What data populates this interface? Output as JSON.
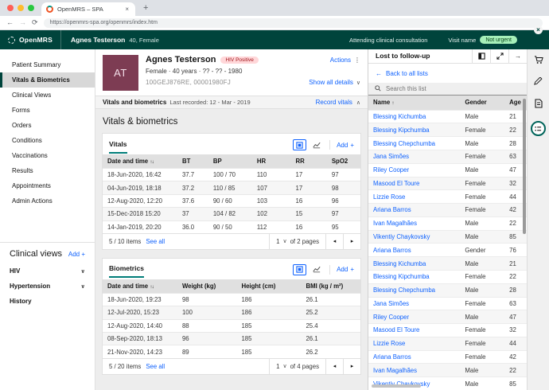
{
  "colors": {
    "header_teal": "#00443c",
    "link_blue": "#0f62fe",
    "tab_underline_teal": "#007d79",
    "avatar_plum": "#7d3c53",
    "badge_hiv_bg": "#ffd7d9",
    "badge_hiv_text": "#a2191f",
    "badge_visit_bg": "#a7f0ba",
    "badge_visit_text": "#044317"
  },
  "browser": {
    "tab_title": "OpenMRS – SPA",
    "url": "https://openmrs-spa.org/openmrs/index.htm"
  },
  "header": {
    "brand": "OpenMRS",
    "patient_name": "Agnes Testerson",
    "patient_meta": "40, Female",
    "status_text": "Attending clinical consultation",
    "visit_label": "Visit name",
    "visit_badge": "Not urgent"
  },
  "sidebar": {
    "items": [
      {
        "label": "Patient Summary"
      },
      {
        "label": "Vitals & Biometrics"
      },
      {
        "label": "Clinical Views"
      },
      {
        "label": "Forms"
      },
      {
        "label": "Orders"
      },
      {
        "label": "Conditions"
      },
      {
        "label": "Vaccinations"
      },
      {
        "label": "Results"
      },
      {
        "label": "Appointments"
      },
      {
        "label": "Admin Actions"
      }
    ],
    "clinical_views": {
      "title": "Clinical views",
      "add_label": "Add",
      "items": [
        {
          "label": "HIV"
        },
        {
          "label": "Hypertension"
        },
        {
          "label": "History"
        }
      ]
    }
  },
  "banner": {
    "initials": "AT",
    "name": "Agnes Testerson",
    "hiv_badge": "HIV Positive",
    "actions_label": "Actions",
    "demographics": "Female  ·  40 years  ·  ?? - ?? - 1980",
    "identifiers": "100GEJ876RE, 00001980FJ",
    "show_all_label": "Show all details"
  },
  "strip": {
    "title": "Vitals and biometrics",
    "last_recorded": "Last recorded: 12 - Mar - 2019",
    "record_label": "Record vitals"
  },
  "main": {
    "page_title": "Vitals & biometrics"
  },
  "vitals": {
    "title": "Vitals",
    "add_label": "Add",
    "columns": [
      "Date and time",
      "BT",
      "BP",
      "HR",
      "RR",
      "SpO2"
    ],
    "rows": [
      [
        "18-Jun-2020, 16:42",
        "37.7",
        "100 / 70",
        "110",
        "17",
        "97"
      ],
      [
        "04-Jun-2019, 18:18",
        "37.2",
        "110 / 85",
        "107",
        "17",
        "98"
      ],
      [
        "12-Aug-2020, 12:20",
        "37.6",
        "90 / 60",
        "103",
        "16",
        "96"
      ],
      [
        "15-Dec-2018 15:20",
        "37",
        "104 / 82",
        "102",
        "15",
        "97"
      ],
      [
        "14-Jan-2019, 20:20",
        "36.0",
        "90 / 50",
        "112",
        "16",
        "95"
      ]
    ],
    "pagination": {
      "count": "5 / 10 items",
      "see_all": "See all",
      "page": "1",
      "of_pages": "of 2 pages"
    }
  },
  "biometrics": {
    "title": "Biometrics",
    "add_label": "Add",
    "columns": [
      "Date and time",
      "Weight (kg)",
      "Height (cm)",
      "BMI (kg / m²)"
    ],
    "rows": [
      [
        "18-Jun-2020, 19:23",
        "98",
        "186",
        "26.1"
      ],
      [
        "12-Jul-2020, 15:23",
        "100",
        "186",
        "25.2"
      ],
      [
        "12-Aug-2020, 14:40",
        "88",
        "185",
        "25.4"
      ],
      [
        "08-Sep-2020, 18:13",
        "96",
        "185",
        "26.1"
      ],
      [
        "21-Nov-2020, 14:23",
        "89",
        "185",
        "26.2"
      ]
    ],
    "pagination": {
      "count": "5 / 20 items",
      "see_all": "See all",
      "page": "1",
      "of_pages": "of 4 pages"
    }
  },
  "patient_list": {
    "title": "Lost to follow-up",
    "back_label": "Back to all lists",
    "search_placeholder": "Search this list",
    "columns": [
      "Name",
      "Gender",
      "Age"
    ],
    "rows": [
      {
        "name": "Blessing Kichumba",
        "gender": "Male",
        "age": "21"
      },
      {
        "name": "Blessing Kipchumba",
        "gender": "Female",
        "age": "22"
      },
      {
        "name": "Blessing Chepchumba",
        "gender": "Male",
        "age": "28"
      },
      {
        "name": "Jana Simões",
        "gender": "Female",
        "age": "63"
      },
      {
        "name": "Riley Cooper",
        "gender": "Male",
        "age": "47"
      },
      {
        "name": "Masood El Toure",
        "gender": "Female",
        "age": "32"
      },
      {
        "name": "Lizzie Rose",
        "gender": "Female",
        "age": "44"
      },
      {
        "name": "Ariana Barros",
        "gender": "Female",
        "age": "42"
      },
      {
        "name": "Ivan Magalhães",
        "gender": "Male",
        "age": "22"
      },
      {
        "name": "Vikentiy Chaykovsky",
        "gender": "Male",
        "age": "85"
      },
      {
        "name": "Ariana Barros",
        "gender": "Gender",
        "age": "76"
      },
      {
        "name": "Blessing Kichumba",
        "gender": "Male",
        "age": "21"
      },
      {
        "name": "Blessing Kipchumba",
        "gender": "Female",
        "age": "22"
      },
      {
        "name": "Blessing Chepchumba",
        "gender": "Male",
        "age": "28"
      },
      {
        "name": "Jana Simões",
        "gender": "Female",
        "age": "63"
      },
      {
        "name": "Riley Cooper",
        "gender": "Male",
        "age": "47"
      },
      {
        "name": "Masood El Toure",
        "gender": "Female",
        "age": "32"
      },
      {
        "name": "Lizzie Rose",
        "gender": "Female",
        "age": "44"
      },
      {
        "name": "Ariana Barros",
        "gender": "Female",
        "age": "42"
      },
      {
        "name": "Ivan Magalhães",
        "gender": "Male",
        "age": "22"
      },
      {
        "name": "Vikentiy Chaykovsky",
        "gender": "Male",
        "age": "85"
      }
    ]
  }
}
